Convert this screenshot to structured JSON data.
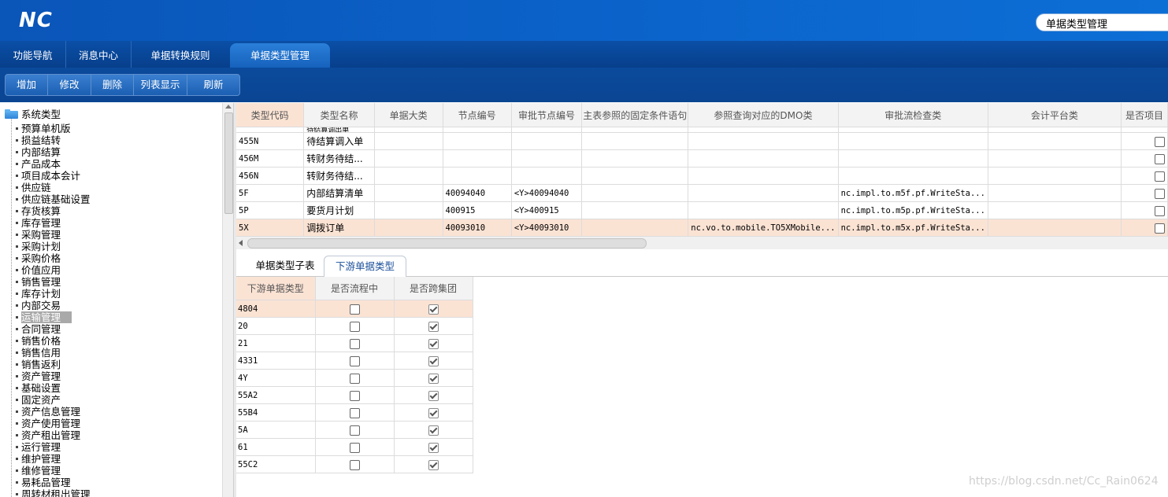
{
  "app": {
    "logo": "NC",
    "search_value": "单据类型管理"
  },
  "tabs": [
    {
      "label": "功能导航"
    },
    {
      "label": "消息中心"
    },
    {
      "label": "单据转换规则"
    },
    {
      "label": "单据类型管理",
      "active": true
    }
  ],
  "toolbar": {
    "add": "增加",
    "edit": "修改",
    "delete": "删除",
    "list_view": "列表显示",
    "refresh": "刷新"
  },
  "tree": {
    "root": "系统类型",
    "selected_index": 16,
    "items": [
      "预算单机版",
      "损益结转",
      "内部结算",
      "产品成本",
      "项目成本会计",
      "供应链",
      "供应链基础设置",
      "存货核算",
      "库存管理",
      "采购管理",
      "采购计划",
      "采购价格",
      "价值应用",
      "销售管理",
      "库存计划",
      "内部交易",
      "运输管理",
      "合同管理",
      "销售价格",
      "销售信用",
      "销售返利",
      "资产管理",
      "基础设置",
      "固定资产",
      "资产信息管理",
      "资产使用管理",
      "资产租出管理",
      "运行管理",
      "维护管理",
      "维修管理",
      "易耗品管理",
      "周转材租出管理"
    ]
  },
  "main_table": {
    "columns": [
      "类型代码",
      "类型名称",
      "单据大类",
      "节点编号",
      "审批节点编号",
      "主表参照的固定条件语句",
      "参照查询对应的DMO类",
      "审批流检查类",
      "会计平台类",
      "是否项目"
    ],
    "partial_row": [
      "",
      "待结算调出单",
      "",
      "",
      "",
      "",
      "",
      "",
      "",
      ""
    ],
    "rows": [
      {
        "code": "455N",
        "name": "待结算调入单",
        "category": "",
        "node": "",
        "approve_node": "",
        "fixed_cond": "",
        "dmo": "",
        "check_class": "",
        "acct_class": "",
        "is_project": false
      },
      {
        "code": "456M",
        "name": "转财务待结...",
        "category": "",
        "node": "",
        "approve_node": "",
        "fixed_cond": "",
        "dmo": "",
        "check_class": "",
        "acct_class": "",
        "is_project": false
      },
      {
        "code": "456N",
        "name": "转财务待结...",
        "category": "",
        "node": "",
        "approve_node": "",
        "fixed_cond": "",
        "dmo": "",
        "check_class": "",
        "acct_class": "",
        "is_project": false
      },
      {
        "code": "5F",
        "name": "内部结算清单",
        "category": "",
        "node": "40094040",
        "approve_node": "<Y>40094040",
        "fixed_cond": "",
        "dmo": "",
        "check_class": "nc.impl.to.m5f.pf.WriteSta...",
        "acct_class": "",
        "is_project": false
      },
      {
        "code": "5P",
        "name": "要货月计划",
        "category": "",
        "node": "400915",
        "approve_node": "<Y>400915",
        "fixed_cond": "",
        "dmo": "",
        "check_class": "nc.impl.to.m5p.pf.WriteSta...",
        "acct_class": "",
        "is_project": false
      },
      {
        "code": "5X",
        "name": "调拨订单",
        "category": "",
        "node": "40093010",
        "approve_node": "<Y>40093010",
        "fixed_cond": "",
        "dmo": "nc.vo.to.mobile.TO5XMobile...",
        "check_class": "nc.impl.to.m5x.pf.WriteSta...",
        "acct_class": "",
        "is_project": false,
        "selected": true
      }
    ]
  },
  "sub_tabs": [
    {
      "label": "单据类型子表"
    },
    {
      "label": "下游单据类型",
      "active": true
    }
  ],
  "sub_table": {
    "columns": [
      "下游单据类型",
      "是否流程中",
      "是否跨集团"
    ],
    "rows": [
      {
        "type": "4804",
        "in_flow": false,
        "cross_group": true,
        "selected": true
      },
      {
        "type": "20",
        "in_flow": false,
        "cross_group": true
      },
      {
        "type": "21",
        "in_flow": false,
        "cross_group": true
      },
      {
        "type": "4331",
        "in_flow": false,
        "cross_group": true
      },
      {
        "type": "4Y",
        "in_flow": false,
        "cross_group": true
      },
      {
        "type": "55A2",
        "in_flow": false,
        "cross_group": true
      },
      {
        "type": "55B4",
        "in_flow": false,
        "cross_group": true
      },
      {
        "type": "5A",
        "in_flow": false,
        "cross_group": true
      },
      {
        "type": "61",
        "in_flow": false,
        "cross_group": true
      },
      {
        "type": "55C2",
        "in_flow": false,
        "cross_group": true
      }
    ]
  },
  "watermark": "https://blog.csdn.net/Cc_Rain0624",
  "colors": {
    "banner": "#0b62c9",
    "selected_row": "#fbe3d4"
  }
}
